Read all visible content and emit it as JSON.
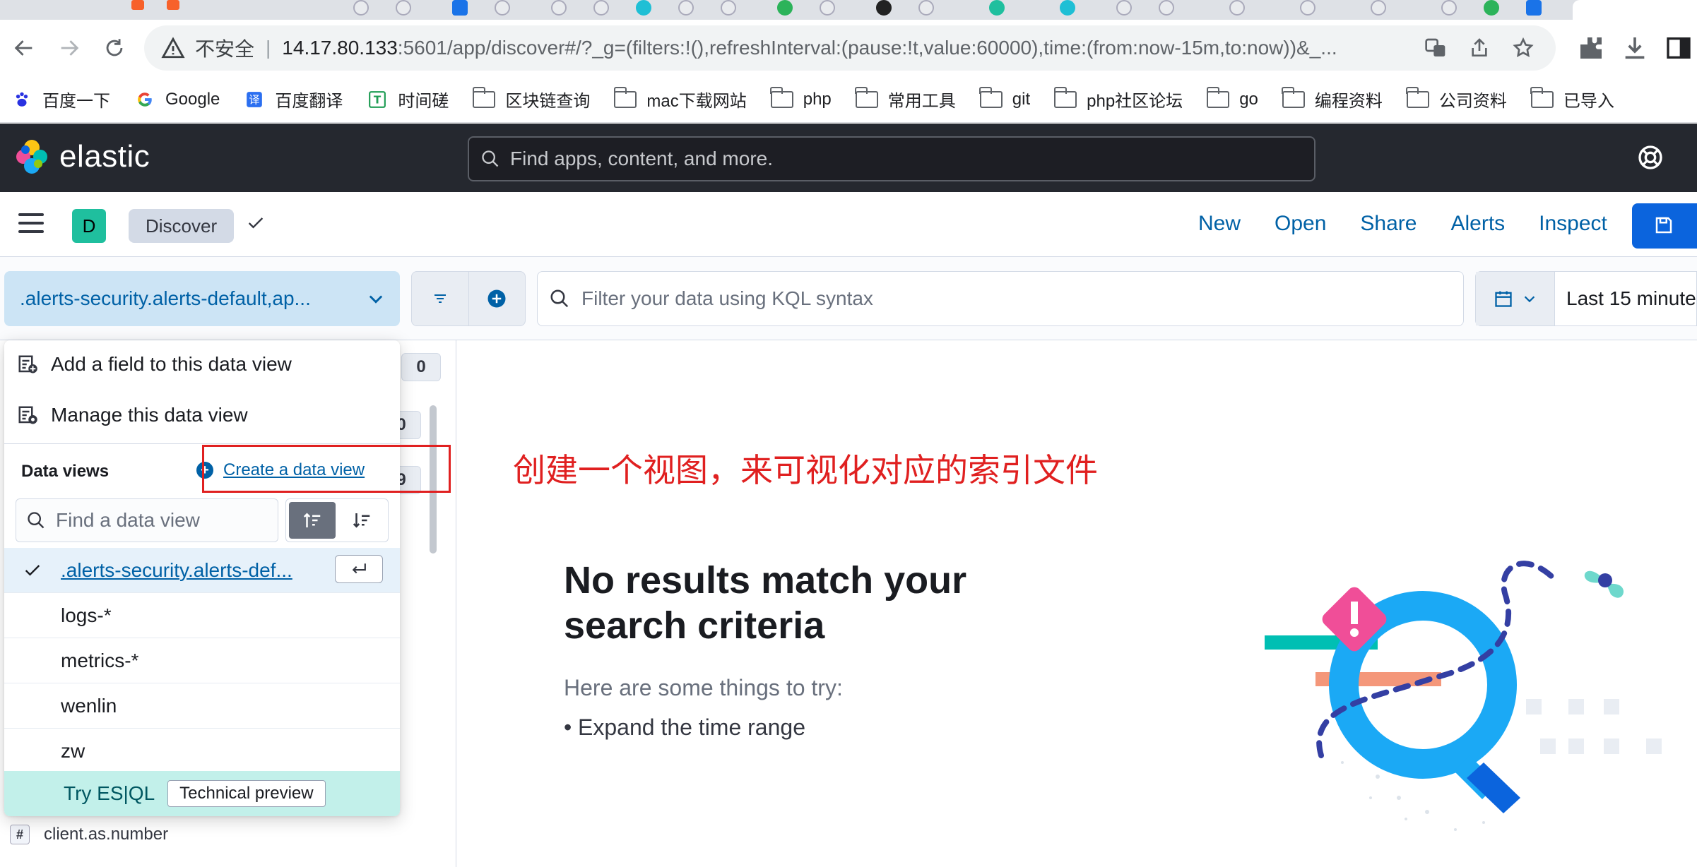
{
  "browser": {
    "omnibox": {
      "security_label": "不安全",
      "url_host": "14.17.80.133",
      "url_rest": ":5601/app/discover#/?_g=(filters:!(),refreshInterval:(pause:!t,value:60000),time:(from:now-15m,to:now))&_..."
    },
    "bookmarks": [
      {
        "label": "百度一下",
        "icon": "baidu-icon"
      },
      {
        "label": "Google",
        "icon": "google-icon"
      },
      {
        "label": "百度翻译",
        "icon": "translate-icon"
      },
      {
        "label": "时间磋",
        "icon": "timestamp-icon"
      },
      {
        "label": "区块链查询",
        "icon": "folder-icon"
      },
      {
        "label": "mac下载网站",
        "icon": "folder-icon"
      },
      {
        "label": "php",
        "icon": "folder-icon"
      },
      {
        "label": "常用工具",
        "icon": "folder-icon"
      },
      {
        "label": "git",
        "icon": "folder-icon"
      },
      {
        "label": "php社区论坛",
        "icon": "folder-icon"
      },
      {
        "label": "go",
        "icon": "folder-icon"
      },
      {
        "label": "编程资料",
        "icon": "folder-icon"
      },
      {
        "label": "公司资料",
        "icon": "folder-icon"
      },
      {
        "label": "已导入",
        "icon": "folder-icon"
      }
    ]
  },
  "kibana": {
    "brand": "elastic",
    "global_search_placeholder": "Find apps, content, and more.",
    "space_initial": "D",
    "breadcrumb": "Discover",
    "top_nav": [
      "New",
      "Open",
      "Share",
      "Alerts",
      "Inspect"
    ],
    "data_view_selected": ".alerts-security.alerts-default,ap...",
    "kql_placeholder": "Filter your data using KQL syntax",
    "time_range": "Last 15 minute"
  },
  "sidebar": {
    "badges": [
      "0",
      "0",
      "9"
    ],
    "visible_field": {
      "type": "#",
      "name": "client.as.number"
    }
  },
  "popover": {
    "add_field": "Add a field to this data view",
    "manage": "Manage this data view",
    "section_title": "Data views",
    "create_link": "Create a data view",
    "find_placeholder": "Find a data view",
    "data_views": [
      {
        "name": ".alerts-security.alerts-def...",
        "selected": true
      },
      {
        "name": "logs-*",
        "selected": false
      },
      {
        "name": "metrics-*",
        "selected": false
      },
      {
        "name": "wenlin",
        "selected": false
      },
      {
        "name": "zw",
        "selected": false
      }
    ],
    "esql_label": "Try ES|QL",
    "esql_badge": "Technical preview"
  },
  "annotation": {
    "text": "创建一个视图，来可视化对应的索引文件",
    "color": "#e02020"
  },
  "main": {
    "empty_title": "No results match your search criteria",
    "empty_subtitle": "Here are some things to try:",
    "suggestion": "Expand the time range"
  },
  "colors": {
    "header_dark": "#25282f",
    "link_blue": "#0061a6",
    "picker_bg": "#cce4f5",
    "esql_bg": "#c2f0ea",
    "primary_button": "#0b64dd"
  }
}
